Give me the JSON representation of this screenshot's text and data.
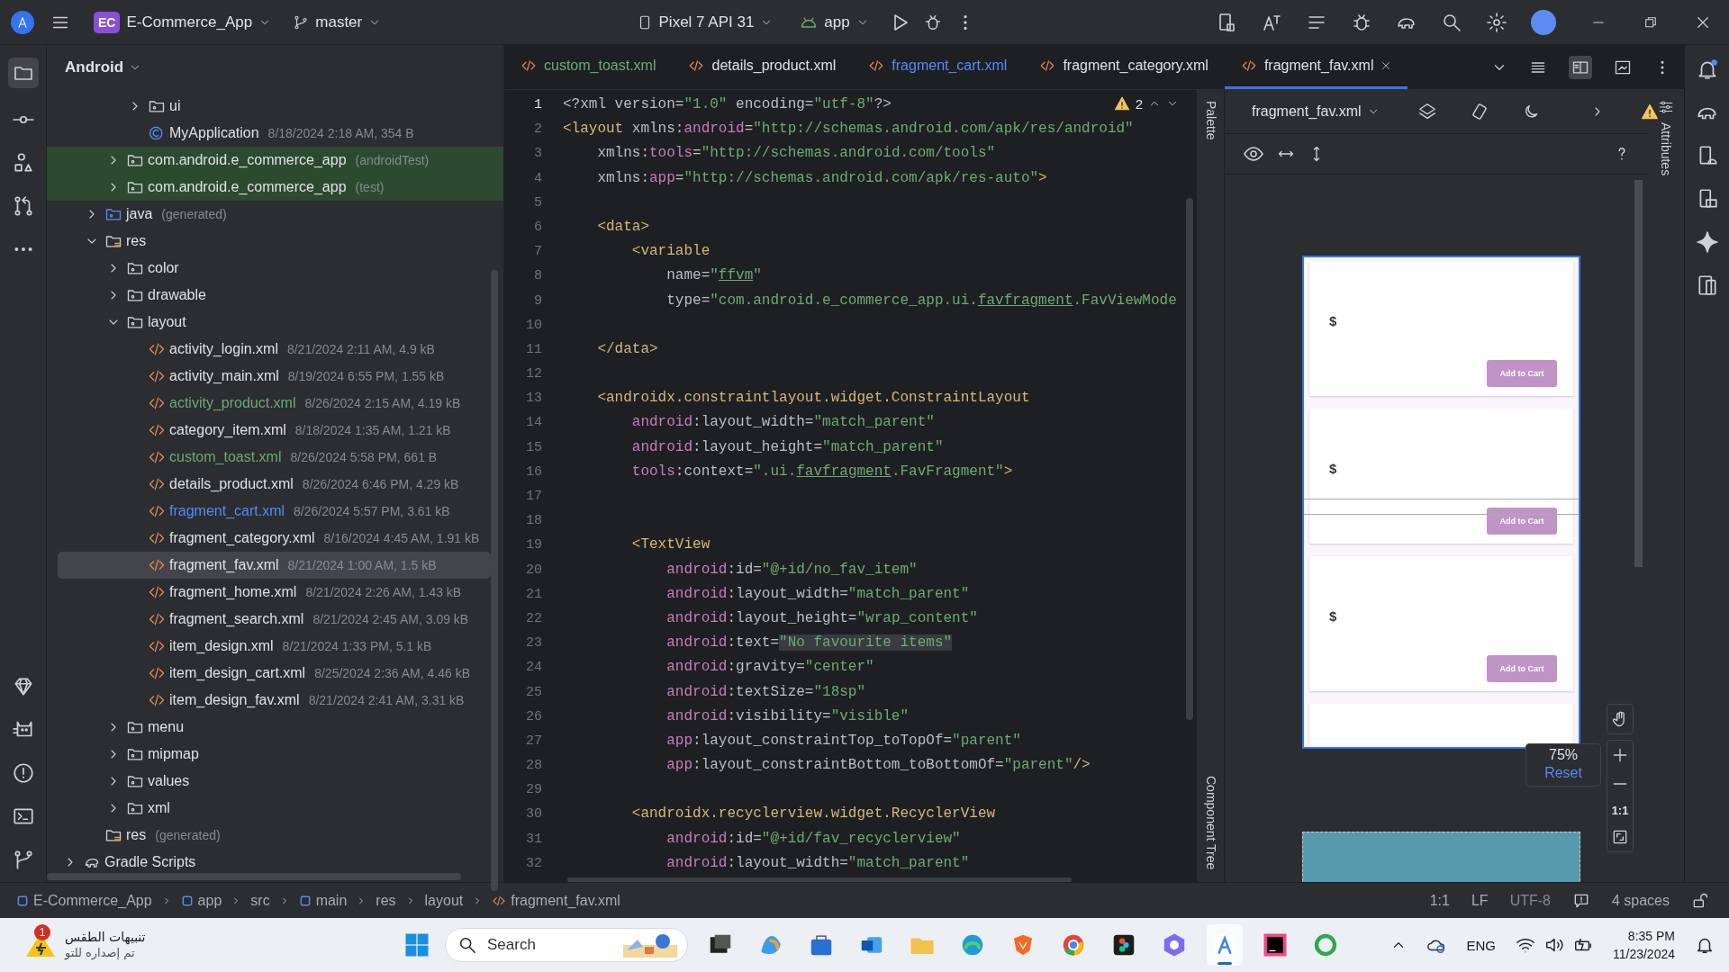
{
  "title_bar": {
    "project_badge": "EC",
    "project": "E-Commerce_App",
    "branch": "master",
    "device": "Pixel 7 API 31",
    "run_config": "app"
  },
  "project_panel": {
    "view": "Android",
    "tree": [
      {
        "children": [
          {
            "children": [
              {
                "children": [
                  {
                    "label": "ui",
                    "kind": "folder",
                    "expanded": false,
                    "selected": false,
                    "highlighted": false
                  },
                  {
                    "label": "MyApplication",
                    "kind": "class",
                    "note": "8/18/2024 2:18 AM, 354 B",
                    "selected": false,
                    "highlighted": false
                  }
                ]
              },
              {
                "label": "com.android.e_commerce_app",
                "note": "(androidTest)",
                "kind": "folder",
                "expanded": false,
                "selected": false,
                "highlighted": true
              },
              {
                "label": "com.android.e_commerce_app",
                "note": "(test)",
                "kind": "folder",
                "expanded": false,
                "selected": false,
                "highlighted": true
              }
            ]
          },
          {
            "label": "java",
            "note": "(generated)",
            "kind": "src-gen",
            "expanded": false,
            "selected": false,
            "highlighted": false
          },
          {
            "label": "res",
            "kind": "res",
            "expanded": true,
            "selected": false,
            "highlighted": false,
            "children": [
              {
                "label": "color",
                "kind": "folder",
                "expanded": false,
                "selected": false,
                "highlighted": false
              },
              {
                "label": "drawable",
                "kind": "folder",
                "expanded": false,
                "selected": false,
                "highlighted": false
              },
              {
                "label": "layout",
                "kind": "folder",
                "expanded": true,
                "selected": false,
                "highlighted": false,
                "children": [
                  {
                    "label": "activity_login.xml",
                    "note": "8/21/2024 2:11 AM, 4.9 kB",
                    "kind": "xml",
                    "selected": false,
                    "highlighted": false
                  },
                  {
                    "label": "activity_main.xml",
                    "note": "8/19/2024 6:55 PM, 1.55 kB",
                    "kind": "xml",
                    "selected": false,
                    "highlighted": false
                  },
                  {
                    "label": "activity_product.xml",
                    "note": "8/26/2024 2:15 AM, 4.19 kB",
                    "kind": "xml",
                    "color": "#6aab73",
                    "selected": false,
                    "highlighted": false
                  },
                  {
                    "label": "category_item.xml",
                    "note": "8/18/2024 1:35 AM, 1.21 kB",
                    "kind": "xml",
                    "selected": false,
                    "highlighted": false
                  },
                  {
                    "label": "custom_toast.xml",
                    "note": "8/26/2024 5:58 PM, 661 B",
                    "kind": "xml",
                    "color": "#6aab73",
                    "selected": false,
                    "highlighted": false
                  },
                  {
                    "label": "details_product.xml",
                    "note": "8/26/2024 6:46 PM, 4.29 kB",
                    "kind": "xml",
                    "selected": false,
                    "highlighted": false
                  },
                  {
                    "label": "fragment_cart.xml",
                    "note": "8/26/2024 5:57 PM, 3.61 kB",
                    "kind": "xml",
                    "color": "#548af7",
                    "selected": false,
                    "highlighted": false
                  },
                  {
                    "label": "fragment_category.xml",
                    "note": "8/16/2024 4:45 AM, 1.91 kB",
                    "kind": "xml",
                    "selected": false,
                    "highlighted": false
                  },
                  {
                    "label": "fragment_fav.xml",
                    "note": "8/21/2024 1:00 AM, 1.5 kB",
                    "kind": "xml",
                    "selected": true,
                    "highlighted": false
                  },
                  {
                    "label": "fragment_home.xml",
                    "note": "8/21/2024 2:26 AM, 1.43 kB",
                    "kind": "xml",
                    "selected": false,
                    "highlighted": false
                  },
                  {
                    "label": "fragment_search.xml",
                    "note": "8/21/2024 2:45 AM, 3.09 kB",
                    "kind": "xml",
                    "selected": false,
                    "highlighted": false
                  },
                  {
                    "label": "item_design.xml",
                    "note": "8/21/2024 1:33 PM, 5.1 kB",
                    "kind": "xml",
                    "selected": false,
                    "highlighted": false
                  },
                  {
                    "label": "item_design_cart.xml",
                    "note": "8/25/2024 2:36 AM, 4.46 kB",
                    "kind": "xml",
                    "selected": false,
                    "highlighted": false
                  },
                  {
                    "label": "item_design_fav.xml",
                    "note": "8/21/2024 2:41 AM, 3.31 kB",
                    "kind": "xml",
                    "selected": false,
                    "highlighted": false
                  }
                ]
              },
              {
                "label": "menu",
                "kind": "folder",
                "expanded": false,
                "selected": false,
                "highlighted": false
              },
              {
                "label": "mipmap",
                "kind": "folder",
                "expanded": false,
                "selected": false,
                "highlighted": false
              },
              {
                "label": "values",
                "kind": "folder",
                "expanded": false,
                "selected": false,
                "highlighted": false
              },
              {
                "label": "xml",
                "kind": "folder",
                "expanded": false,
                "selected": false,
                "highlighted": false
              }
            ]
          },
          {
            "label": "res",
            "note": "(generated)",
            "kind": "res",
            "selected": false,
            "highlighted": false
          }
        ]
      },
      {
        "label": "Gradle Scripts",
        "kind": "gradle",
        "expanded": false,
        "selected": false,
        "highlighted": false
      }
    ]
  },
  "tabs": [
    {
      "label": "custom_toast.xml",
      "color": "#6aab73",
      "selected": false
    },
    {
      "label": "details_product.xml",
      "selected": false
    },
    {
      "label": "fragment_cart.xml",
      "color": "#548af7",
      "selected": false
    },
    {
      "label": "fragment_category.xml",
      "selected": false
    },
    {
      "label": "fragment_fav.xml",
      "selected": true
    }
  ],
  "editor": {
    "warnings": "2",
    "lines": [
      {
        "n": "1",
        "current": true,
        "tokens": [
          {
            "kind": "plain",
            "text": "<?xml version="
          },
          {
            "kind": "str",
            "text": "\"1.0\""
          },
          {
            "kind": "plain",
            "text": " encoding="
          },
          {
            "kind": "str",
            "text": "\"utf-8\""
          },
          {
            "kind": "plain",
            "text": "?>"
          }
        ]
      },
      {
        "n": "2",
        "current": false,
        "tokens": [
          {
            "kind": "tag",
            "text": "<layout "
          },
          {
            "kind": "plain",
            "text": "xmlns:"
          },
          {
            "kind": "ns",
            "text": "android"
          },
          {
            "kind": "plain",
            "text": "="
          },
          {
            "kind": "str",
            "text": "\"http://schemas.android.com/apk/res/android\""
          }
        ]
      },
      {
        "n": "3",
        "current": false,
        "tokens": [
          {
            "kind": "plain",
            "text": "    xmlns:"
          },
          {
            "kind": "ns",
            "text": "tools"
          },
          {
            "kind": "plain",
            "text": "="
          },
          {
            "kind": "str",
            "text": "\"http://schemas.android.com/tools\""
          }
        ]
      },
      {
        "n": "4",
        "current": false,
        "tokens": [
          {
            "kind": "plain",
            "text": "    xmlns:"
          },
          {
            "kind": "ns",
            "text": "app"
          },
          {
            "kind": "plain",
            "text": "="
          },
          {
            "kind": "str",
            "text": "\"http://schemas.android.com/apk/res-auto\""
          },
          {
            "kind": "tag",
            "text": ">"
          }
        ]
      },
      {
        "n": "5",
        "current": false
      },
      {
        "n": "6",
        "current": false,
        "tokens": [
          {
            "kind": "tag",
            "text": "    <data>"
          }
        ]
      },
      {
        "n": "7",
        "current": false,
        "tokens": [
          {
            "kind": "tag",
            "text": "        <variable"
          }
        ]
      },
      {
        "n": "8",
        "current": false,
        "tokens": [
          {
            "kind": "plain",
            "text": "            name="
          },
          {
            "kind": "str",
            "text": "\""
          },
          {
            "kind": "typo",
            "text": "ffvm"
          },
          {
            "kind": "str",
            "text": "\""
          }
        ]
      },
      {
        "n": "9",
        "current": false,
        "tokens": [
          {
            "kind": "plain",
            "text": "            type="
          },
          {
            "kind": "str",
            "text": "\"com.android.e_commerce_app.ui."
          },
          {
            "kind": "typo",
            "text": "favfragment"
          },
          {
            "kind": "str",
            "text": ".FavViewMode"
          }
        ]
      },
      {
        "n": "10",
        "current": false
      },
      {
        "n": "11",
        "current": false,
        "tokens": [
          {
            "kind": "tag",
            "text": "    </data>"
          }
        ]
      },
      {
        "n": "12",
        "current": false
      },
      {
        "n": "13",
        "current": false,
        "tokens": [
          {
            "kind": "tag",
            "text": "    <androidx.constraintlayout.widget.ConstraintLayout"
          }
        ]
      },
      {
        "n": "14",
        "current": false,
        "tokens": [
          {
            "kind": "ns",
            "text": "        android"
          },
          {
            "kind": "plain",
            "text": ":layout_width="
          },
          {
            "kind": "str",
            "text": "\"match_parent\""
          }
        ]
      },
      {
        "n": "15",
        "current": false,
        "tokens": [
          {
            "kind": "ns",
            "text": "        android"
          },
          {
            "kind": "plain",
            "text": ":layout_height="
          },
          {
            "kind": "str",
            "text": "\"match_parent\""
          }
        ]
      },
      {
        "n": "16",
        "current": false,
        "tokens": [
          {
            "kind": "ns",
            "text": "        tools"
          },
          {
            "kind": "plain",
            "text": ":context="
          },
          {
            "kind": "str",
            "text": "\".ui."
          },
          {
            "kind": "typo",
            "text": "favfragment"
          },
          {
            "kind": "str",
            "text": ".FavFragment\""
          },
          {
            "kind": "tag",
            "text": ">"
          }
        ]
      },
      {
        "n": "17",
        "current": false
      },
      {
        "n": "18",
        "current": false
      },
      {
        "n": "19",
        "current": false,
        "tokens": [
          {
            "kind": "tag",
            "text": "        <TextView"
          }
        ]
      },
      {
        "n": "20",
        "current": false,
        "tokens": [
          {
            "kind": "ns",
            "text": "            android"
          },
          {
            "kind": "plain",
            "text": ":id="
          },
          {
            "kind": "str",
            "text": "\"@+id/no_fav_item\""
          }
        ]
      },
      {
        "n": "21",
        "current": false,
        "tokens": [
          {
            "kind": "ns",
            "text": "            android"
          },
          {
            "kind": "plain",
            "text": ":layout_width="
          },
          {
            "kind": "str",
            "text": "\"match_parent\""
          }
        ]
      },
      {
        "n": "22",
        "current": false,
        "tokens": [
          {
            "kind": "ns",
            "text": "            android"
          },
          {
            "kind": "plain",
            "text": ":layout_height="
          },
          {
            "kind": "str",
            "text": "\"wrap_content\""
          }
        ]
      },
      {
        "n": "23",
        "current": false,
        "tokens": [
          {
            "kind": "ns",
            "text": "            android"
          },
          {
            "kind": "plain",
            "text": ":text="
          },
          {
            "kind": "marked",
            "text": "\"No favourite items\""
          }
        ]
      },
      {
        "n": "24",
        "current": false,
        "tokens": [
          {
            "kind": "ns",
            "text": "            android"
          },
          {
            "kind": "plain",
            "text": ":gravity="
          },
          {
            "kind": "str",
            "text": "\"center\""
          }
        ]
      },
      {
        "n": "25",
        "current": false,
        "tokens": [
          {
            "kind": "ns",
            "text": "            android"
          },
          {
            "kind": "plain",
            "text": ":textSize="
          },
          {
            "kind": "str",
            "text": "\"18sp\""
          }
        ]
      },
      {
        "n": "26",
        "current": false,
        "tokens": [
          {
            "kind": "ns",
            "text": "            android"
          },
          {
            "kind": "plain",
            "text": ":visibility="
          },
          {
            "kind": "str",
            "text": "\"visible\""
          }
        ]
      },
      {
        "n": "27",
        "current": false,
        "tokens": [
          {
            "kind": "ns",
            "text": "            app"
          },
          {
            "kind": "plain",
            "text": ":layout_constraintTop_toTopOf="
          },
          {
            "kind": "str",
            "text": "\"parent\""
          }
        ]
      },
      {
        "n": "28",
        "current": false,
        "tokens": [
          {
            "kind": "ns",
            "text": "            app"
          },
          {
            "kind": "plain",
            "text": ":layout_constraintBottom_toBottomOf="
          },
          {
            "kind": "str",
            "text": "\"parent\""
          },
          {
            "kind": "tag",
            "text": "/>"
          }
        ]
      },
      {
        "n": "29",
        "current": false
      },
      {
        "n": "30",
        "current": false,
        "tokens": [
          {
            "kind": "tag",
            "text": "        <androidx.recyclerview.widget.RecyclerView"
          }
        ]
      },
      {
        "n": "31",
        "current": false,
        "tokens": [
          {
            "kind": "ns",
            "text": "            android"
          },
          {
            "kind": "plain",
            "text": ":id="
          },
          {
            "kind": "str",
            "text": "\"@+id/fav_recyclerview\""
          }
        ]
      },
      {
        "n": "32",
        "current": false,
        "tokens": [
          {
            "kind": "ns",
            "text": "            android"
          },
          {
            "kind": "plain",
            "text": ":layout_width="
          },
          {
            "kind": "str",
            "text": "\"match_parent\""
          }
        ]
      }
    ]
  },
  "side_labels": {
    "palette": "Palette",
    "component_tree": "Component Tree",
    "attributes": "Attributes"
  },
  "preview": {
    "file": "fragment_fav.xml",
    "cards": [
      {
        "price": "$",
        "button": "Add to Cart"
      },
      {
        "price": "$",
        "button": "Add to Cart"
      },
      {
        "price": "$",
        "button": "Add to Cart"
      }
    ],
    "zoom": {
      "percent": "75%",
      "reset": "Reset",
      "actual_size": "1:1"
    }
  },
  "status_bar": {
    "breadcrumbs": [
      {
        "label": "E-Commerce_App",
        "kind": "module"
      },
      {
        "label": "app",
        "kind": "module"
      },
      {
        "label": "src",
        "kind": "plain"
      },
      {
        "label": "main",
        "kind": "module"
      },
      {
        "label": "res",
        "kind": "plain"
      },
      {
        "label": "layout",
        "kind": "plain"
      },
      {
        "label": "fragment_fav.xml",
        "kind": "xml"
      }
    ],
    "position": "1:1",
    "line_separator": "LF",
    "encoding": "UTF-8",
    "indent": "4 spaces"
  },
  "taskbar": {
    "weather": {
      "title": "تنبيهات الطقس",
      "subtitle": "تم إصداره للتو",
      "badge": "1"
    },
    "search": {
      "placeholder": "Search"
    },
    "apps": [
      {
        "kind": "taskview",
        "selected": false
      },
      {
        "kind": "copilot",
        "selected": false
      },
      {
        "kind": "store",
        "selected": false
      },
      {
        "kind": "mail",
        "selected": false
      },
      {
        "kind": "explorer",
        "selected": false
      },
      {
        "kind": "edge",
        "selected": false
      },
      {
        "kind": "shield",
        "selected": false
      },
      {
        "kind": "chrome",
        "selected": false
      },
      {
        "kind": "figma",
        "selected": false
      },
      {
        "kind": "hexagon",
        "selected": false
      },
      {
        "kind": "studio",
        "selected": true
      },
      {
        "kind": "ij",
        "selected": false
      },
      {
        "kind": "ring",
        "selected": false
      }
    ],
    "tray": {
      "language": "ENG",
      "time": "8:35 PM",
      "date": "11/23/2024"
    }
  }
}
